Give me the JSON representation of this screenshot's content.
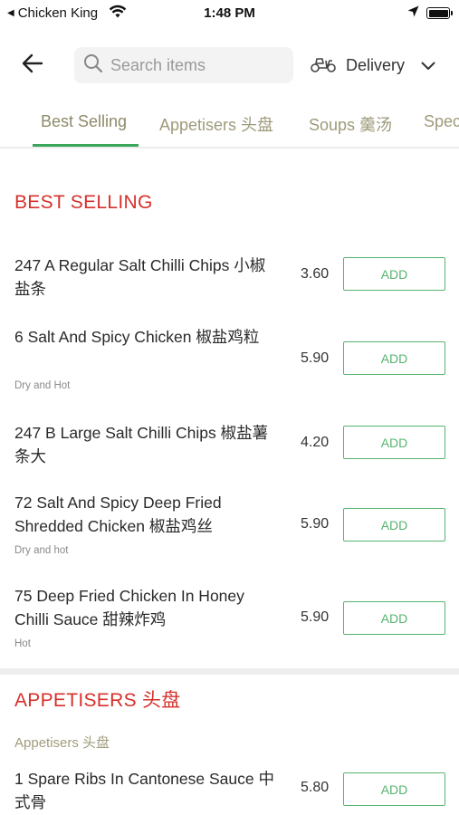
{
  "status_bar": {
    "back_app": "Chicken King",
    "time": "1:48 PM"
  },
  "header": {
    "back_icon": "arrow-left-icon",
    "search_placeholder": "Search items",
    "delivery_label": "Delivery",
    "delivery_icon": "scooter-icon"
  },
  "tabs": [
    {
      "label": "Best Selling",
      "active": true
    },
    {
      "label": "Appetisers 头盘",
      "active": false
    },
    {
      "label": "Soups 羹汤",
      "active": false
    },
    {
      "label": "Spec",
      "active": false
    }
  ],
  "sections": [
    {
      "title": "BEST SELLING",
      "items": [
        {
          "name": "247 A Regular Salt Chilli Chips 小椒盐条",
          "note": "",
          "price": "3.60",
          "button": "ADD"
        },
        {
          "name": "6 Salt And Spicy Chicken 椒盐鸡粒",
          "note": "Dry and Hot",
          "price": "5.90",
          "button": "ADD"
        },
        {
          "name": "247 B Large Salt Chilli Chips 椒盐薯条大",
          "note": "",
          "price": "4.20",
          "button": "ADD"
        },
        {
          "name": "72 Salt And Spicy Deep Fried Shredded Chicken 椒盐鸡丝",
          "note": "Dry and hot",
          "price": "5.90",
          "button": "ADD"
        },
        {
          "name": "75 Deep Fried Chicken In Honey Chilli Sauce 甜辣炸鸡",
          "note": "Hot",
          "price": "5.90",
          "button": "ADD"
        }
      ]
    },
    {
      "title": "APPETISERS 头盘",
      "subtitle": "Appetisers 头盘",
      "items": [
        {
          "name": "1 Spare Ribs In Cantonese Sauce 中式骨",
          "note": "",
          "price": "5.80",
          "button": "ADD"
        }
      ]
    }
  ],
  "colors": {
    "accent_green": "#56b46f",
    "section_red": "#d6302b",
    "tab_text": "#9e9a7a"
  }
}
